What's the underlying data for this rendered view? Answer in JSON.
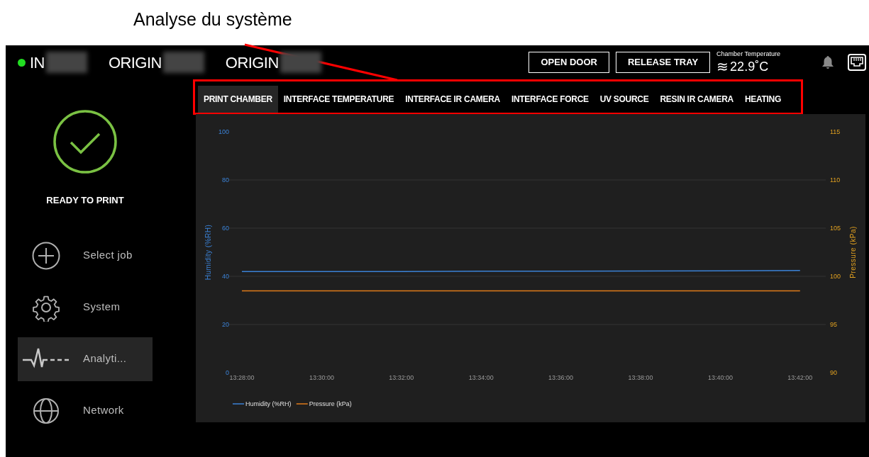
{
  "annotation": {
    "text": "Analyse du système"
  },
  "header": {
    "printers": [
      {
        "label": "IN",
        "online": true
      },
      {
        "label": "ORIGIN",
        "online": false
      },
      {
        "label": "ORIGIN",
        "online": false
      }
    ],
    "buttons": [
      "OPEN DOOR",
      "RELEASE TRAY"
    ],
    "chamber": {
      "label": "Chamber Temperature",
      "icon": "≋",
      "value": "22.9˚C"
    }
  },
  "sidebar": {
    "status": "READY TO PRINT",
    "items": [
      {
        "label": "Select job",
        "kind": "plus",
        "selected": false
      },
      {
        "label": "System",
        "kind": "gear",
        "selected": false
      },
      {
        "label": "Analyti...",
        "kind": "pulse",
        "selected": true
      },
      {
        "label": "Network",
        "kind": "globe",
        "selected": false
      }
    ]
  },
  "tabs": [
    {
      "label": "PRINT CHAMBER",
      "selected": true
    },
    {
      "label": "INTERFACE TEMPERATURE",
      "selected": false
    },
    {
      "label": "INTERFACE IR CAMERA",
      "selected": false
    },
    {
      "label": "INTERFACE FORCE",
      "selected": false
    },
    {
      "label": "UV SOURCE",
      "selected": false
    },
    {
      "label": "RESIN IR CAMERA",
      "selected": false
    },
    {
      "label": "HEATING",
      "selected": false
    }
  ],
  "chart": {
    "chart_data": {
      "type": "line",
      "ylabel": "Humidity (%RH)",
      "y2label": "Pressure (kPa)",
      "categories": [
        "13:28:00",
        "13:30:00",
        "13:32:00",
        "13:34:00",
        "13:36:00",
        "13:38:00",
        "13:40:00",
        "13:42:00"
      ],
      "grid": true,
      "legend": "bottom",
      "ylim": [
        0,
        100
      ],
      "yticks": [
        0,
        20,
        40,
        60,
        80,
        100
      ],
      "y2lim": [
        90,
        115
      ],
      "y2ticks": [
        90,
        95,
        100,
        105,
        110,
        115
      ],
      "series": [
        {
          "name": "Humidity (%RH)",
          "color": "#3b82d6",
          "values": [
            42,
            42,
            42,
            42.1,
            42.1,
            42.2,
            42.3,
            42.4
          ]
        },
        {
          "name": "Pressure (kPa)",
          "color": "#e07b1a",
          "axis": "y2",
          "values": [
            98.5,
            98.5,
            98.5,
            98.5,
            98.5,
            98.5,
            98.5,
            98.5
          ]
        }
      ]
    }
  }
}
